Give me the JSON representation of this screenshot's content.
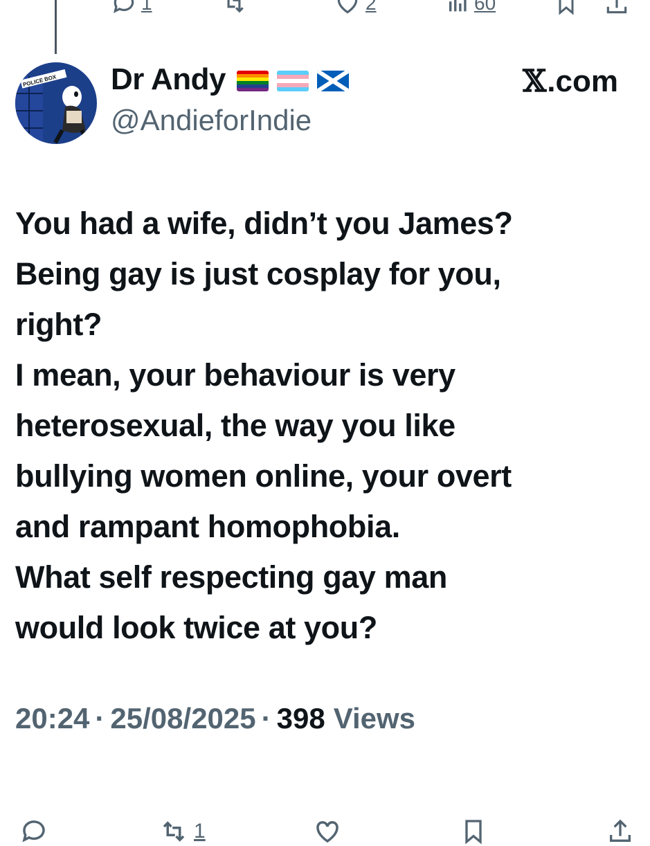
{
  "top_actions": {
    "replies": "1",
    "likes": "2",
    "views": "60"
  },
  "tweet": {
    "display_name": "Dr Andy",
    "flags": [
      "rainbow-flag",
      "transgender-flag",
      "scotland-flag"
    ],
    "handle": "@AndieforIndie",
    "site_label_x": "𝕏",
    "site_label_rest": ".com",
    "avatar_text": "POLICE BOX",
    "text": "You had a wife, didn’t you James?\nBeing gay is just cosplay for you,\nright?\nI mean, your behaviour is very\nheterosexual, the way you like\nbullying women online, your overt\nand rampant homophobia.\nWhat self respecting gay man\nwould look twice at you?",
    "time": "20:24",
    "date": "25/08/2025",
    "separator": "·",
    "views_count": "398",
    "views_label": "Views"
  },
  "bottom_actions": {
    "retweets": "1"
  },
  "colors": {
    "text": "#0f1419",
    "secondary": "#536471",
    "background": "#ffffff"
  },
  "icons": [
    "reply-icon",
    "retweet-icon",
    "like-icon",
    "views-icon",
    "bookmark-icon",
    "share-icon"
  ]
}
